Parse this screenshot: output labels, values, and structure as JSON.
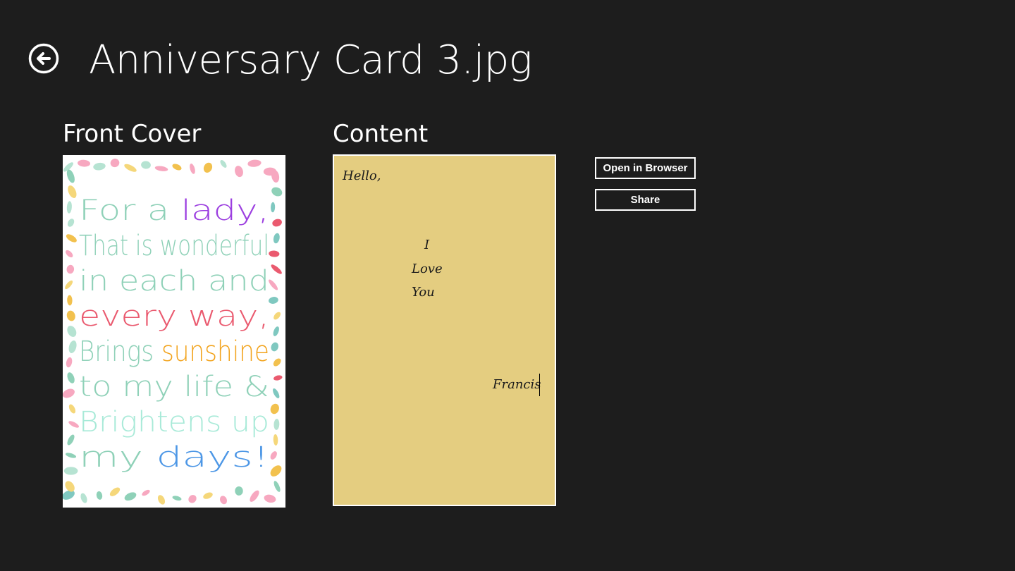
{
  "header": {
    "title": "Anniversary Card 3.jpg",
    "back_icon": "back-arrow-circle-icon"
  },
  "sections": {
    "front_label": "Front Cover",
    "content_label": "Content"
  },
  "front_cover": {
    "lines": [
      {
        "text": "For a ",
        "accent": "lady,",
        "color": "#8fd1b8",
        "accent_color": "#9c3fe0"
      },
      {
        "text": "That is wonderful",
        "color": "#8fd1b8"
      },
      {
        "text": "in each and",
        "color": "#8fd1b8"
      },
      {
        "text": "every way,",
        "color": "#ea5a6f"
      },
      {
        "text": "Brings ",
        "accent": "sunshine",
        "color": "#8fd1b8",
        "accent_color": "#f2a31c"
      },
      {
        "text": "to my life &",
        "color": "#8fd1b8"
      },
      {
        "text": "Brightens up",
        "color": "#a8ead8"
      },
      {
        "text": "my ",
        "accent": "days!",
        "color": "#8fd1b8",
        "accent_color": "#4d97e6"
      }
    ]
  },
  "content_card": {
    "greeting": "Hello,",
    "line1": "I",
    "line2": "Love",
    "line3": "You",
    "signature": "Francis",
    "background": "#e4cd80"
  },
  "actions": {
    "open_browser_label": "Open in Browser",
    "share_label": "Share"
  }
}
